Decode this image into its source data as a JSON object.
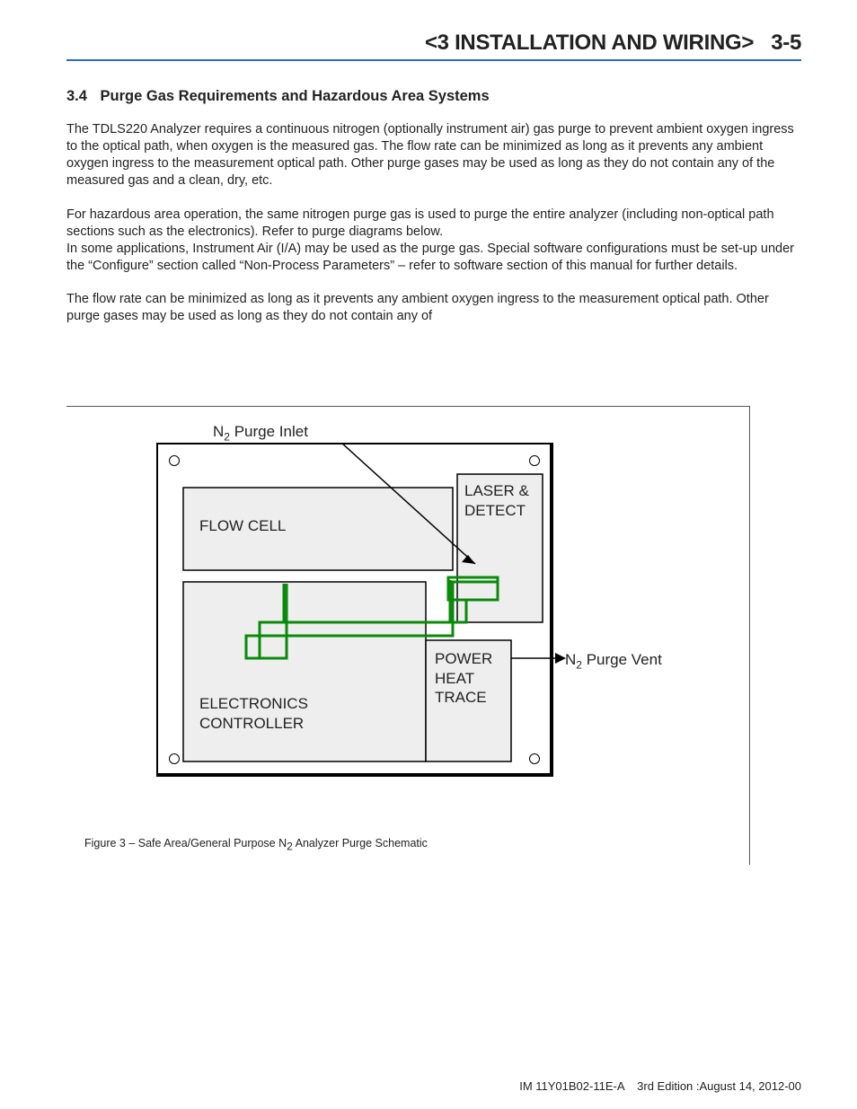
{
  "header": {
    "chapter_title": "<3 INSTALLATION AND WIRING>",
    "page_no": "3-5"
  },
  "section": {
    "number": "3.4",
    "title": "Purge Gas Requirements and Hazardous Area Systems"
  },
  "paragraphs": {
    "p1": "The TDLS220 Analyzer requires a continuous nitrogen (optionally instrument air) gas purge to prevent ambient oxygen ingress to the optical path, when oxygen is the measured gas. The flow rate can be minimized as long as it prevents any ambient oxygen ingress to the measurement optical path. Other purge gases may be used as long as they do not contain any of the measured gas and a clean, dry, etc.",
    "p2": "For hazardous area operation, the same nitrogen purge gas is used to purge the entire analyzer (including non-optical path sections such as the electronics).  Refer to purge diagrams below.\nIn some applications, Instrument Air (I/A) may be used as the purge gas. Special software configurations must be set-up under the “Configure” section called “Non-Process Parameters” – refer to software section of this manual for further details.",
    "p3": "The flow rate can be minimized as long as it prevents any ambient oxygen ingress to the measurement optical path. Other purge gases may be used as long as they do not contain any of"
  },
  "diagram": {
    "purge_inlet_label_prefix": "N",
    "purge_inlet_label_sub": "2",
    "purge_inlet_label_rest": " Purge Inlet",
    "purge_vent_label_prefix": "N",
    "purge_vent_label_sub": "2",
    "purge_vent_label_rest": " Purge Vent",
    "flow_cell": "FLOW CELL",
    "laser_detect_l1": "LASER &",
    "laser_detect_l2": "DETECT",
    "power_l1": "POWER",
    "power_l2": "HEAT",
    "power_l3": "TRACE",
    "elec_l1": "ELECTRONICS",
    "elec_l2": "CONTROLLER"
  },
  "figure": {
    "caption_prefix": "Figure 3 – Safe Area/General Purpose N",
    "caption_sub": "2",
    "caption_rest": " Analyzer Purge Schematic"
  },
  "footer": {
    "doc_id": "IM 11Y01B02-11E-A",
    "edition": "3rd Edition :August 14, 2012-00"
  }
}
